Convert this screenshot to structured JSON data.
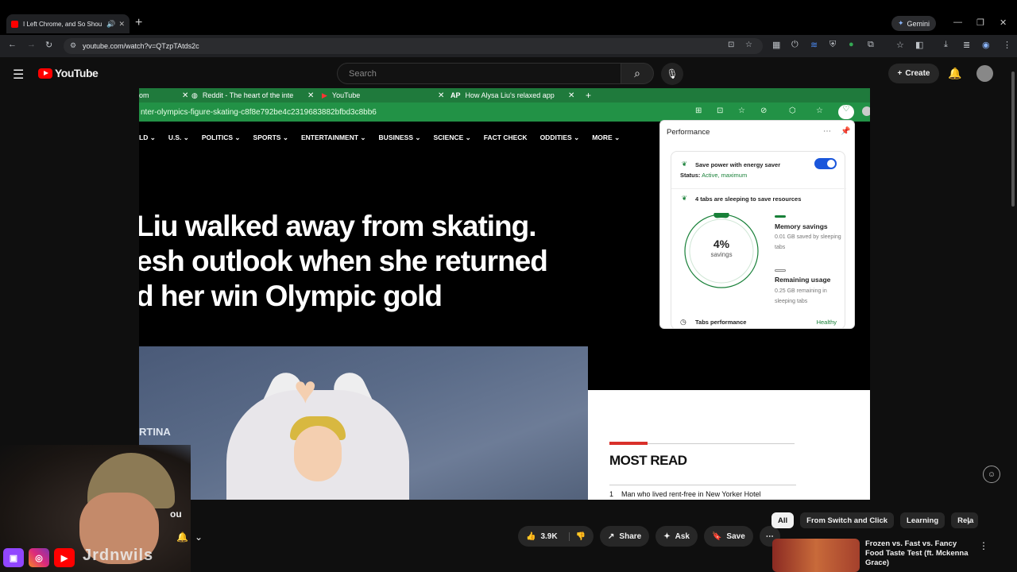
{
  "browser": {
    "tab_title": "I Left Chrome, and So Shou",
    "url": "youtube.com/watch?v=QTzpTAtds2c",
    "gemini_label": "Gemini"
  },
  "youtube": {
    "logo_text": "YouTube",
    "search_placeholder": "Search",
    "create_label": "Create"
  },
  "video": {
    "inner_tabs": [
      {
        "label": "om"
      },
      {
        "label": "Reddit - The heart of the inte"
      },
      {
        "label": "YouTube"
      },
      {
        "label": "How Alysa Liu's relaxed app"
      }
    ],
    "inner_url": "nter-olympics-figure-skating-c8f8e792be4c2319683882bfbd3c8bb6",
    "nav_items": [
      "LD",
      "U.S.",
      "POLITICS",
      "SPORTS",
      "ENTERTAINMENT",
      "BUSINESS",
      "SCIENCE",
      "FACT CHECK",
      "ODDITIES",
      "MORE"
    ],
    "headline_lines": [
      "Liu walked away from skating.",
      "esh outlook when she returned",
      "d her win Olympic gold"
    ],
    "photo_sign": "RTINA",
    "most_read": {
      "title": "MOST READ",
      "item_number": "1",
      "item_text": "Man who lived rent-free in New Yorker Hotel"
    },
    "performance": {
      "title": "Performance",
      "energy_saver": "Save power with energy saver",
      "status_label": "Status:",
      "status_value": "Active, maximum",
      "sleeping": "4 tabs are sleeping to save resources",
      "savings_pct": "4%",
      "savings_label": "savings",
      "savings_fraction": 0.04,
      "memory_title": "Memory savings",
      "memory_sub": "0.01 GB saved by sleeping tabs",
      "remaining_title": "Remaining usage",
      "remaining_sub": "0.25 GB remaining in sleeping tabs",
      "tabs_perf": "Tabs performance",
      "tabs_perf_status": "Healthy"
    }
  },
  "below_video": {
    "channel_title": "ou",
    "likes": "3.9K",
    "share": "Share",
    "ask": "Ask",
    "save": "Save"
  },
  "overlay": {
    "handle": "Jrdnwils"
  },
  "chips": [
    "All",
    "From Switch and Click",
    "Learning",
    "Rela"
  ],
  "recommendation": {
    "title": "Frozen vs. Fast vs. Fancy Food Taste Test (ft. Mckenna Grace)"
  },
  "colors": {
    "youtube_red": "#ff0000",
    "chrome_green": "#229246",
    "toggle_blue": "#1a56db",
    "healthy_green": "#188038"
  }
}
